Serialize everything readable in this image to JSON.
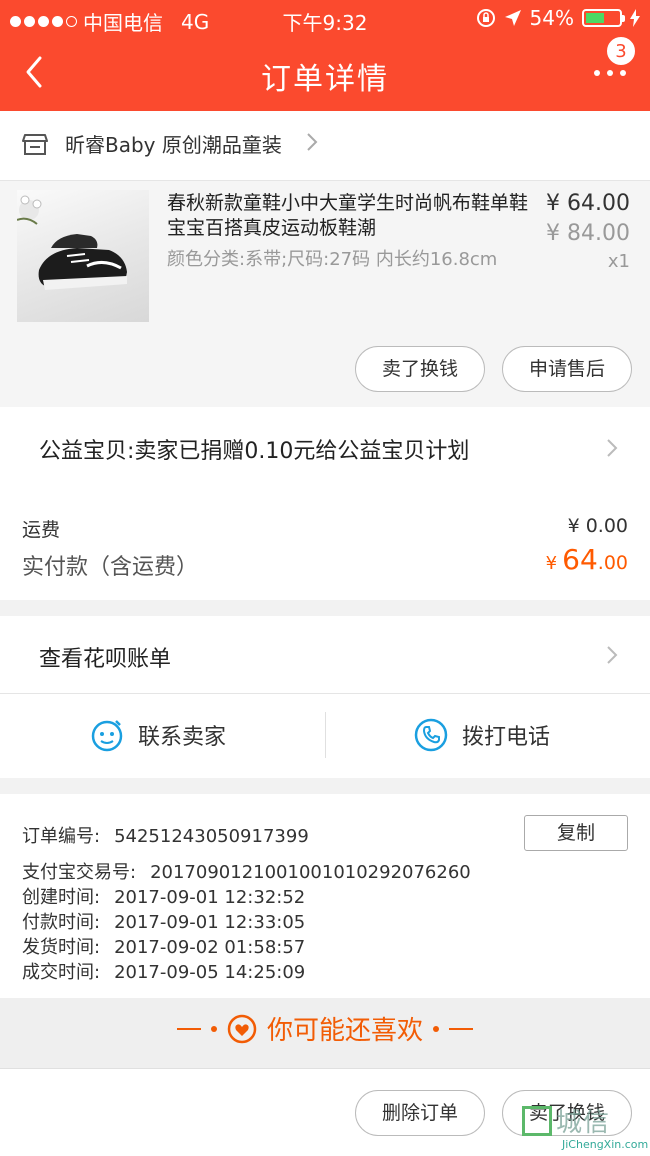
{
  "status_bar": {
    "carrier": "中国电信",
    "network": "4G",
    "time": "下午9:32",
    "battery": "54%"
  },
  "nav": {
    "title": "订单详情",
    "badge": "3"
  },
  "shop": {
    "name": "昕睿Baby 原创潮品童装"
  },
  "product": {
    "title": "春秋新款童鞋小中大童学生时尚帆布鞋单鞋宝宝百搭真皮运动板鞋潮",
    "spec": "颜色分类:系带;尺码:27码 内长约16.8cm",
    "price": "¥ 64.00",
    "original_price": "¥ 84.00",
    "quantity": "x1",
    "buttons": {
      "resell": "卖了换钱",
      "after_sale": "申请售后"
    }
  },
  "charity": {
    "text": "公益宝贝:卖家已捐赠0.10元给公益宝贝计划"
  },
  "totals": {
    "shipping_label": "运费",
    "shipping_value": "¥ 0.00",
    "paid_label": "实付款（含运费）",
    "paid_currency": "¥",
    "paid_int": "64",
    "paid_dec": ".00"
  },
  "huabei": {
    "text": "查看花呗账单"
  },
  "contact": {
    "seller": "联系卖家",
    "phone": "拨打电话"
  },
  "order_info": {
    "order_no_label": "订单编号:",
    "order_no": "54251243050917399",
    "copy": "复制",
    "alipay_label": "支付宝交易号:",
    "alipay_no": "2017090121001001010292076260",
    "created_label": "创建时间:",
    "created": "2017-09-01 12:32:52",
    "paid_label": "付款时间:",
    "paid": "2017-09-01 12:33:05",
    "shipped_label": "发货时间:",
    "shipped": "2017-09-02 01:58:57",
    "completed_label": "成交时间:",
    "completed": "2017-09-05 14:25:09"
  },
  "recommend": {
    "title": "你可能还喜欢"
  },
  "bottom": {
    "delete": "删除订单",
    "resell": "卖了换钱"
  },
  "watermark": {
    "cn": "城信",
    "en": "JiChengXin.com"
  },
  "colors": {
    "brand": "#fb4a2e",
    "price_accent": "#ff5a00",
    "recommend": "#f25c05",
    "contact_icon": "#1a9fe0"
  }
}
